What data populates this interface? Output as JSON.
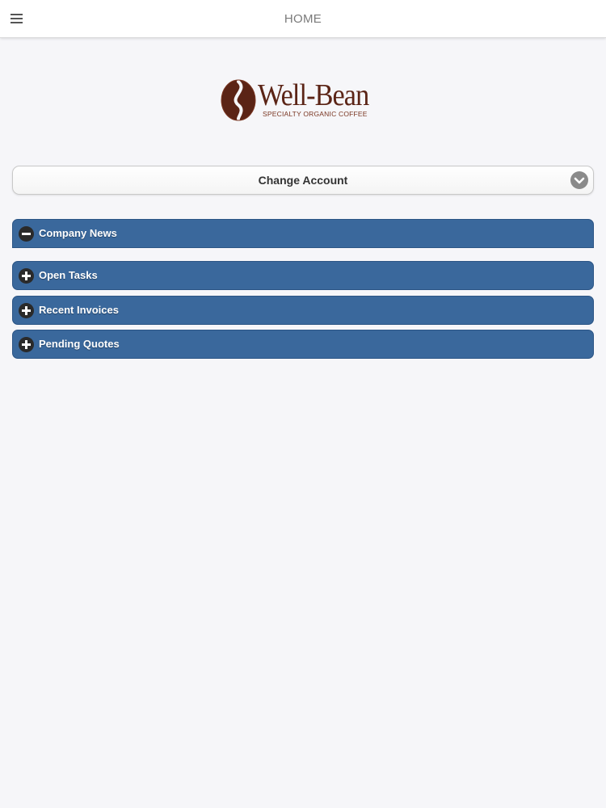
{
  "header": {
    "title": "HOME",
    "menu_icon": "hamburger-menu-icon"
  },
  "logo": {
    "name": "Well-Bean",
    "tagline": "SPECIALTY ORGANIC COFFEE",
    "icon": "coffee-bean-icon",
    "brand_color": "#5b2416"
  },
  "account_select": {
    "label": "Change Account",
    "icon": "chevron-down-icon"
  },
  "panels": [
    {
      "label": "Company News",
      "state": "expanded",
      "icon": "minus-icon"
    },
    {
      "label": "Open Tasks",
      "state": "collapsed",
      "icon": "plus-icon"
    },
    {
      "label": "Recent Invoices",
      "state": "collapsed",
      "icon": "plus-icon"
    },
    {
      "label": "Pending Quotes",
      "state": "collapsed",
      "icon": "plus-icon"
    }
  ],
  "colors": {
    "panel_bg": "#3a689c",
    "page_bg": "#f6f6f9"
  }
}
